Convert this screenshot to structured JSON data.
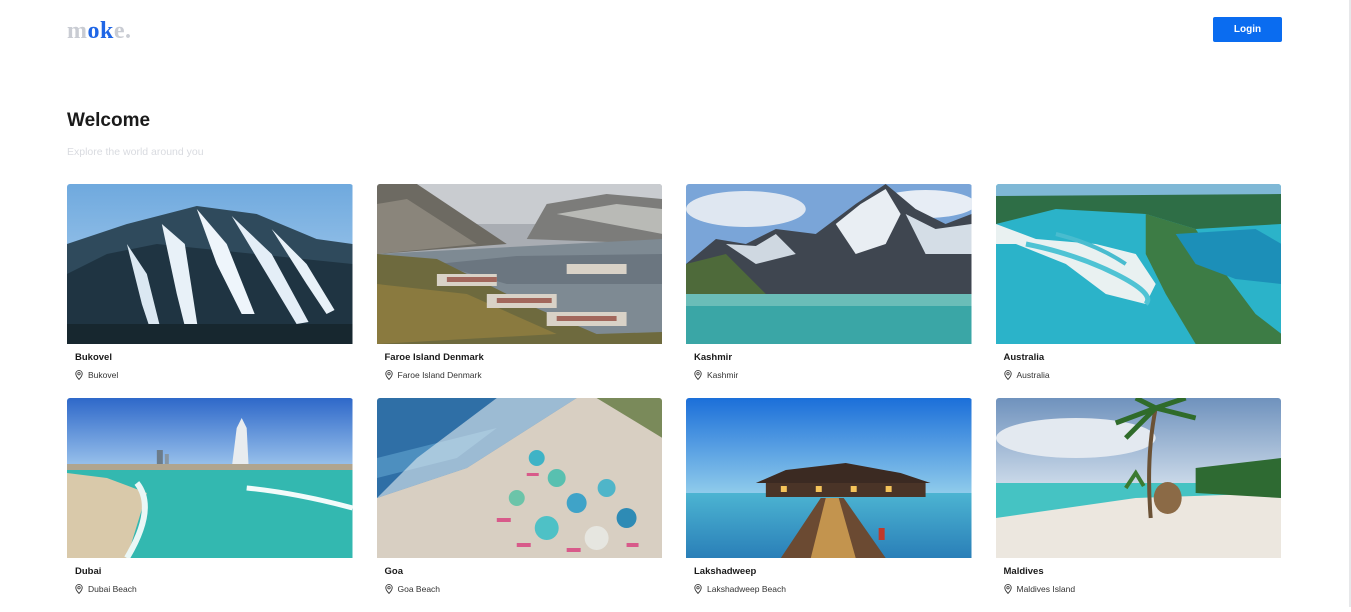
{
  "header": {
    "logo_parts": [
      "m",
      "ok",
      "e."
    ],
    "login_label": "Login"
  },
  "hero": {
    "title": "Welcome",
    "subtitle": "Explore the world around you"
  },
  "colors": {
    "accent": "#0a6cf0",
    "logo_gray": "#c9ccd3",
    "logo_blue": "#1f66e6"
  },
  "destinations": [
    {
      "title": "Bukovel",
      "location": "Bukovel",
      "scene": "ski-mountain"
    },
    {
      "title": "Faroe Island Denmark",
      "location": "Faroe Island Denmark",
      "scene": "fjord-village"
    },
    {
      "title": "Kashmir",
      "location": "Kashmir",
      "scene": "snow-peaks-lake"
    },
    {
      "title": "Australia",
      "location": "Australia",
      "scene": "aerial-inlet"
    },
    {
      "title": "Dubai",
      "location": "Dubai Beach",
      "scene": "beach-skyline"
    },
    {
      "title": "Goa",
      "location": "Goa Beach",
      "scene": "beach-umbrellas"
    },
    {
      "title": "Lakshadweep",
      "location": "Lakshadweep Beach",
      "scene": "water-villa-pier"
    },
    {
      "title": "Maldives",
      "location": "Maldives Island",
      "scene": "palm-beach"
    }
  ]
}
